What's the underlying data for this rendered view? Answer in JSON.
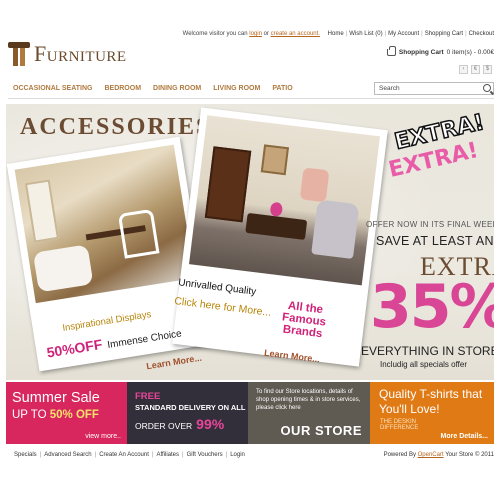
{
  "header": {
    "welcome_prefix": "Welcome visitor you can",
    "login_link": "login",
    "or_text": "or",
    "create_account_link": "create an account.",
    "top_links": [
      "Home",
      "Wish List (0)",
      "My Account",
      "Shopping Cart",
      "Checkout"
    ],
    "cart_label": "Shopping Cart",
    "cart_summary": "0 item(s) - 0.00€",
    "cart_arrows": [
      "‹",
      "€",
      "$"
    ]
  },
  "logo": {
    "text": "Furniture"
  },
  "menu": {
    "items": [
      "OCCASIONAL SEATING",
      "BEDROOM",
      "DINING ROOM",
      "LIVING ROOM",
      "PATIO"
    ],
    "search_value": "Search"
  },
  "banner": {
    "title": "ACCESSORIES",
    "photo1_caption_top": "Inspirational Displays",
    "photo1_caption_offer": "50%OFF",
    "photo1_caption_choice": "Immense Choice",
    "photo1_learn": "Learn More...",
    "photo2_caption_quality": "Unrivalled Quality",
    "photo2_caption_click": "Click here for More...",
    "photo2_caption_brands": "All the Famous Brands",
    "photo2_learn": "Learn More...",
    "extra1": "EXTRA!",
    "extra2": "EXTRA!",
    "offer_now": "OFFER NOW IN ITS FINAL WEEK",
    "save_at_least": "SAVE AT LEAST AN",
    "extra_big": "EXTRA",
    "percent": "35%",
    "everything": "EVERYTHING IN STORE",
    "includig": "Includig all specials offer"
  },
  "promos": {
    "summer": {
      "title": "Summer Sale",
      "up_to": "UP TO",
      "discount": "50% OFF",
      "link": "view more.."
    },
    "delivery": {
      "free": "FREE",
      "standard": "STANDARD DELIVERY ON ALL",
      "order_over": "ORDER OVER",
      "amount": "99%"
    },
    "store": {
      "desc": "To find our Store locations, details of shop opening times & in store services, please click here",
      "title": "OUR STORE"
    },
    "tshirts": {
      "title": "Quality T-shirts that You'll Love!",
      "sub": "THE DESKIN DIFFERENCE",
      "link": "More Details..."
    }
  },
  "footer": {
    "links": [
      "Specials",
      "Advanced Search",
      "Create An Account",
      "Affiliates",
      "Gift Vouchers",
      "Login"
    ],
    "powered_prefix": "Powered By",
    "powered_link": "OpenCart",
    "powered_suffix": "Your Store © 2011"
  },
  "colors": {
    "brand_brown": "#6b4c33",
    "menu_gold": "#b07a3f",
    "pink": "#d84695",
    "summer_bg": "#d8265e",
    "delivery_bg": "#332f3a",
    "store_bg": "#5f5a52",
    "tshirt_bg": "#e07a15"
  },
  "icons": [
    "logo-mark-icon",
    "cart-icon",
    "search-icon"
  ]
}
